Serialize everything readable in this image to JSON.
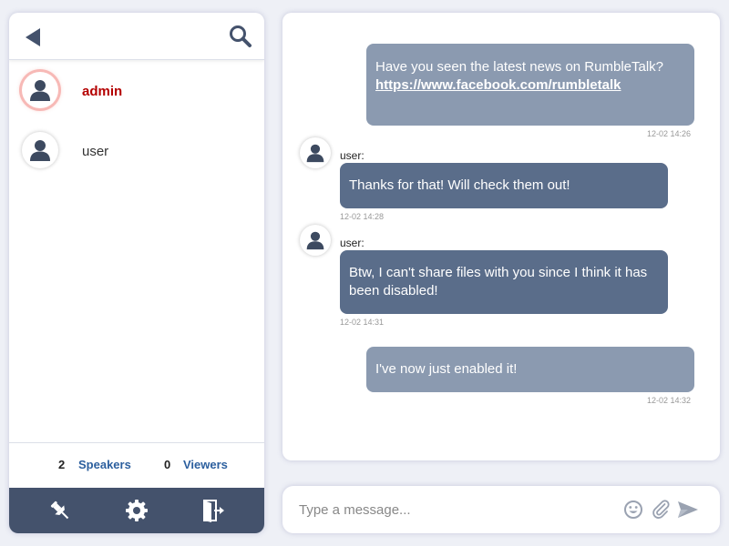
{
  "sidebar": {
    "users": [
      {
        "name": "admin",
        "role": "admin",
        "active": true
      },
      {
        "name": "user",
        "role": "user",
        "active": false
      }
    ],
    "stats": {
      "speakers_count": "2",
      "speakers_label": "Speakers",
      "viewers_count": "0",
      "viewers_label": "Viewers"
    },
    "toolbar_icons": [
      "pin-icon",
      "gear-icon",
      "exit-door-icon"
    ]
  },
  "chat": {
    "messages": [
      {
        "own": true,
        "text": "Have you seen the latest news on RumbleTalk?",
        "link": "https://www.facebook.com/rumbletalk",
        "time": "12-02 14:26"
      },
      {
        "own": false,
        "sender": "user:",
        "text": "Thanks for that! Will check them out!",
        "time": "12-02 14:28"
      },
      {
        "own": false,
        "sender": "user:",
        "text": "Btw, I can't share files with you since I think it has been disabled!",
        "time": "12-02 14:31"
      },
      {
        "own": true,
        "text": "I've now just enabled it!",
        "time": "12-02 14:32"
      }
    ]
  },
  "input": {
    "placeholder": "Type a message...",
    "value": "",
    "icons": [
      "smiley-icon",
      "paperclip-icon",
      "send-icon"
    ]
  },
  "colors": {
    "own_bubble": "#8b9ab0",
    "other_bubble": "#5a6d8a",
    "toolbar_bg": "#44526c",
    "admin_name": "#b40000",
    "stat_label": "#2c5f9e",
    "page_bg": "#eef0f6"
  }
}
